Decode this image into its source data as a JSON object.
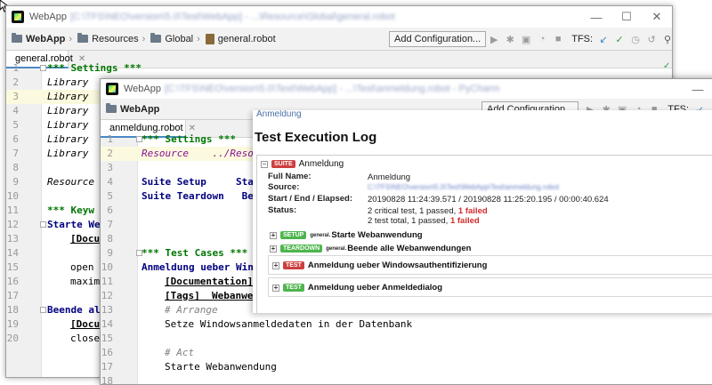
{
  "back_window": {
    "title_app": "WebApp",
    "title_path": "[C:\\TFS\\NEO\\version\\5.0\\Test\\WebApp] - ...\\Resource\\Global\\general.robot",
    "breadcrumbs": [
      "WebApp",
      "Resources",
      "Global",
      "general.robot"
    ],
    "add_configuration": "Add Configuration...",
    "tfs_label": "TFS:",
    "tab_label": "general.robot",
    "lines": [
      {
        "n": "1",
        "text": "*** Settings ***"
      },
      {
        "n": "2",
        "text": "Library"
      },
      {
        "n": "3",
        "text": "Library"
      },
      {
        "n": "4",
        "text": "Library"
      },
      {
        "n": "5",
        "text": "Library"
      },
      {
        "n": "6",
        "text": "Library"
      },
      {
        "n": "7",
        "text": "Library"
      },
      {
        "n": "8",
        "text": ""
      },
      {
        "n": "9",
        "text": "Resource"
      },
      {
        "n": "10",
        "text": ""
      },
      {
        "n": "11",
        "text": "*** Keyw"
      },
      {
        "n": "12",
        "text": "Starte We"
      },
      {
        "n": "13",
        "text": "[Docu"
      },
      {
        "n": "14",
        "text": ""
      },
      {
        "n": "15",
        "text": "open"
      },
      {
        "n": "16",
        "text": "maxim"
      },
      {
        "n": "17",
        "text": ""
      },
      {
        "n": "18",
        "text": "Beende al"
      },
      {
        "n": "19",
        "text": "[Docu"
      },
      {
        "n": "20",
        "text": "close"
      }
    ]
  },
  "front_window": {
    "title_app": "WebApp",
    "title_path": "[C:\\TFS\\NEO\\version\\5.0\\Test\\WebApp] - ...\\Test\\anmeldung.robot - PyCharm",
    "project_label": "WebApp",
    "add_configuration": "Add Configuration...",
    "tfs_label": "TFS:",
    "tab_label": "anmeldung.robot",
    "lines": [
      {
        "n": "1",
        "text": "*** Settings ***"
      },
      {
        "n": "2",
        "text": "Resource    ../Resource"
      },
      {
        "n": "3",
        "text": ""
      },
      {
        "n": "4",
        "text": "Suite Setup     Star"
      },
      {
        "n": "5",
        "text": "Suite Teardown   Been"
      },
      {
        "n": "6",
        "text": ""
      },
      {
        "n": "7",
        "text": ""
      },
      {
        "n": "8",
        "text": ""
      },
      {
        "n": "9",
        "text": "*** Test Cases ***"
      },
      {
        "n": "10",
        "text": "Anmeldung ueber Wind"
      },
      {
        "n": "11",
        "text": "[Documentation]"
      },
      {
        "n": "12",
        "text": "[Tags]  Webanwen"
      },
      {
        "n": "13",
        "text": "# Arrange"
      },
      {
        "n": "14",
        "text": "Setze Windowsanmeldedaten in der Datenbank"
      },
      {
        "n": "15",
        "text": ""
      },
      {
        "n": "16",
        "text": "# Act"
      },
      {
        "n": "17",
        "text": "Starte Webanwendung"
      },
      {
        "n": "18",
        "text": ""
      }
    ]
  },
  "log": {
    "edge_label": "Anmeldung",
    "title": "Test Execution Log",
    "suite_badge": "SUITE",
    "suite_name": "Anmeldung",
    "full_name_label": "Full Name:",
    "full_name_value": "Anmeldung",
    "source_label": "Source:",
    "source_value": "C:\\TFS\\NEO\\version\\5.0\\Test\\WebApp\\Test\\anmeldung.robot",
    "start_label": "Start / End / Elapsed:",
    "start_value": "20190828 11:24:39.571 / 20190828 11:25:20.195 / 00:00:40.624",
    "status_label": "Status:",
    "status_critical_prefix": "2 critical test, 1 passed,",
    "status_critical_failed": "1 failed",
    "status_total_prefix": "2 test total, 1 passed,",
    "status_total_failed": "1 failed",
    "setup_badge": "SETUP",
    "setup_small": "general.",
    "setup_name": "Starte Webanwendung",
    "teardown_badge": "TEARDOWN",
    "teardown_small": "general.",
    "teardown_name": "Beende alle Webanwendungen",
    "tests": [
      {
        "badge": "TEST",
        "status": "fail",
        "name": "Anmeldung ueber Windowsauthentifizierung"
      },
      {
        "badge": "TEST",
        "status": "pass",
        "name": "Anmeldung ueber Anmeldedialog"
      }
    ]
  },
  "colors": {
    "fail_red": "#ce3e3e",
    "pass_green": "#4eb54e",
    "keyword_blue": "#000080",
    "settings_green": "#007700"
  }
}
